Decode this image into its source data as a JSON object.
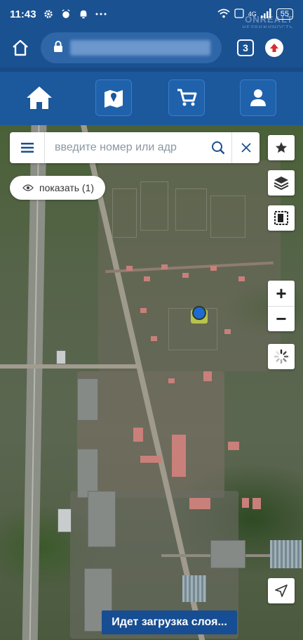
{
  "status_bar": {
    "time": "11:43",
    "network": "4G",
    "battery": "55",
    "icons": [
      "gear-icon",
      "alarm-icon",
      "bell-icon",
      "more-icon",
      "wifi-icon",
      "volte-icon",
      "signal-icon"
    ]
  },
  "watermark": {
    "brand": "ONREALT",
    "tagline": "НЕДВИЖИМОСТЬ"
  },
  "browser": {
    "tab_count": "3",
    "url_hidden": true
  },
  "app_nav": {
    "items": [
      "home-icon",
      "map-icon",
      "cart-icon",
      "user-icon"
    ]
  },
  "search": {
    "placeholder": "введите номер или адр"
  },
  "show_button": {
    "label": "показать (1)"
  },
  "map_controls": {
    "zoom_in": "+",
    "zoom_out": "−"
  },
  "loading": {
    "text": "Идет загрузка слоя..."
  },
  "colors": {
    "header": "#1a5191",
    "nav": "#1b589c",
    "loading_bg": "#174d92",
    "marker": "#1e6ad1",
    "upload_red": "#d32f2f"
  }
}
